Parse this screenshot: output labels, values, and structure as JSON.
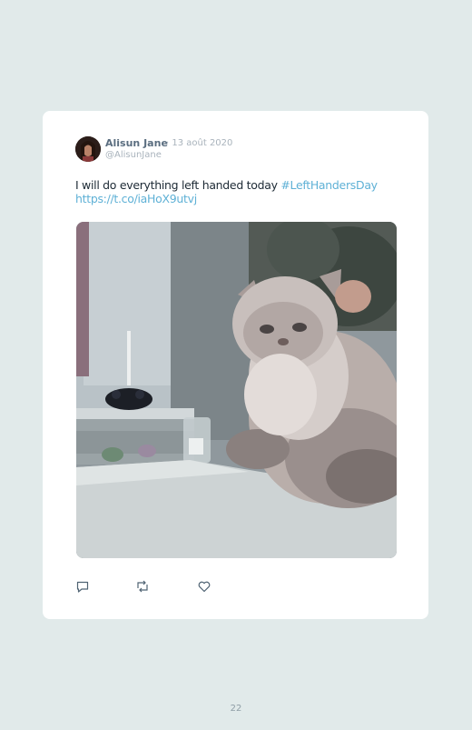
{
  "tweet": {
    "author_name": "Alisun Jane",
    "date": "· 13 août 2020",
    "handle": "@AlisunJane",
    "text_plain": "I will do everything left handed today ",
    "hashtag": "#LeftHandersDay",
    "link": "https://t.co/iaHoX9utvj",
    "media_icon": "cat-photo",
    "actions": [
      {
        "name": "reply",
        "icon": "speech-bubble-icon"
      },
      {
        "name": "retweet",
        "icon": "retweet-icon"
      },
      {
        "name": "like",
        "icon": "heart-icon"
      }
    ]
  },
  "page_number": "22",
  "colors": {
    "background": "#e1eaea",
    "card": "#ffffff",
    "link": "#5fb1d6",
    "name": "#5b6e80",
    "muted": "#a9b3bc"
  }
}
